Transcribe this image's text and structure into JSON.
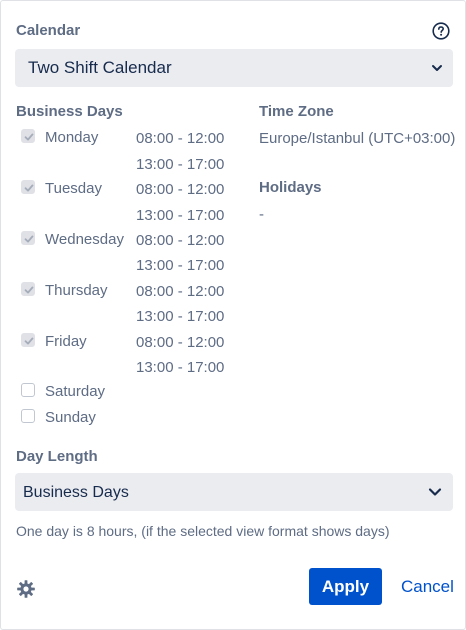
{
  "calendar": {
    "label": "Calendar",
    "help_icon": "question-circle-icon",
    "selected": "Two Shift Calendar"
  },
  "business_days": {
    "label": "Business Days",
    "days": [
      {
        "name": "Monday",
        "checked": true,
        "shifts": [
          "08:00 - 12:00",
          "13:00 - 17:00"
        ]
      },
      {
        "name": "Tuesday",
        "checked": true,
        "shifts": [
          "08:00 - 12:00",
          "13:00 - 17:00"
        ]
      },
      {
        "name": "Wednesday",
        "checked": true,
        "shifts": [
          "08:00 - 12:00",
          "13:00 - 17:00"
        ]
      },
      {
        "name": "Thursday",
        "checked": true,
        "shifts": [
          "08:00 - 12:00",
          "13:00 - 17:00"
        ]
      },
      {
        "name": "Friday",
        "checked": true,
        "shifts": [
          "08:00 - 12:00",
          "13:00 - 17:00"
        ]
      },
      {
        "name": "Saturday",
        "checked": false,
        "shifts": []
      },
      {
        "name": "Sunday",
        "checked": false,
        "shifts": []
      }
    ]
  },
  "time_zone": {
    "label": "Time Zone",
    "value": "Europe/Istanbul (UTC+03:00)"
  },
  "holidays": {
    "label": "Holidays",
    "value": "-"
  },
  "day_length": {
    "label": "Day Length",
    "selected": "Business Days",
    "note": "One day is 8 hours, (if the selected view format shows days)"
  },
  "footer": {
    "settings_icon": "gear-icon",
    "apply_label": "Apply",
    "cancel_label": "Cancel"
  },
  "colors": {
    "primary": "#0052cc",
    "muted_text": "#5e6c84",
    "select_bg": "#ebecf0"
  }
}
